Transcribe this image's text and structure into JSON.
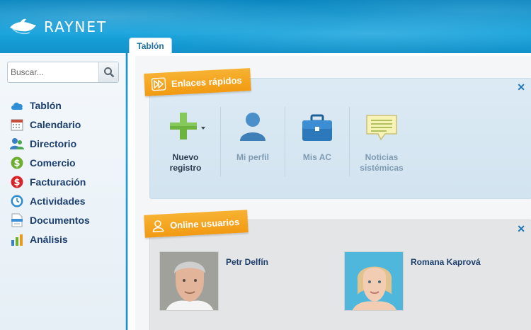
{
  "app": {
    "logo_text": "RAYNET"
  },
  "tabs": [
    {
      "label": "Tablón"
    }
  ],
  "search": {
    "placeholder": "Buscar..."
  },
  "sidebar": {
    "items": [
      {
        "label": "Tablón",
        "icon": "cloud-icon"
      },
      {
        "label": "Calendario",
        "icon": "calendar-icon"
      },
      {
        "label": "Directorio",
        "icon": "contacts-icon"
      },
      {
        "label": "Comercio",
        "icon": "dollar-icon"
      },
      {
        "label": "Facturación",
        "icon": "invoice-dollar-icon"
      },
      {
        "label": "Actividades",
        "icon": "clock-icon"
      },
      {
        "label": "Documentos",
        "icon": "document-icon"
      },
      {
        "label": "Análisis",
        "icon": "bar-chart-icon"
      }
    ]
  },
  "quick_links": {
    "title": "Enlaces rápidos",
    "items": [
      {
        "label_line1": "Nuevo",
        "label_line2": "registro",
        "icon": "plus-icon"
      },
      {
        "label_line1": "Mi perfil",
        "label_line2": "",
        "icon": "person-icon"
      },
      {
        "label_line1": "Mis AC",
        "label_line2": "",
        "icon": "briefcase-icon"
      },
      {
        "label_line1": "Noticias",
        "label_line2": "sistémicas",
        "icon": "speech-bubble-icon"
      }
    ]
  },
  "online_users": {
    "title": "Online usuarios",
    "users": [
      {
        "name": "Petr Delfín"
      },
      {
        "name": "Romana Kaprová"
      }
    ]
  },
  "colors": {
    "accent": "#f29a12",
    "header": "#17a3dc",
    "nav_text": "#1c3f6e"
  }
}
